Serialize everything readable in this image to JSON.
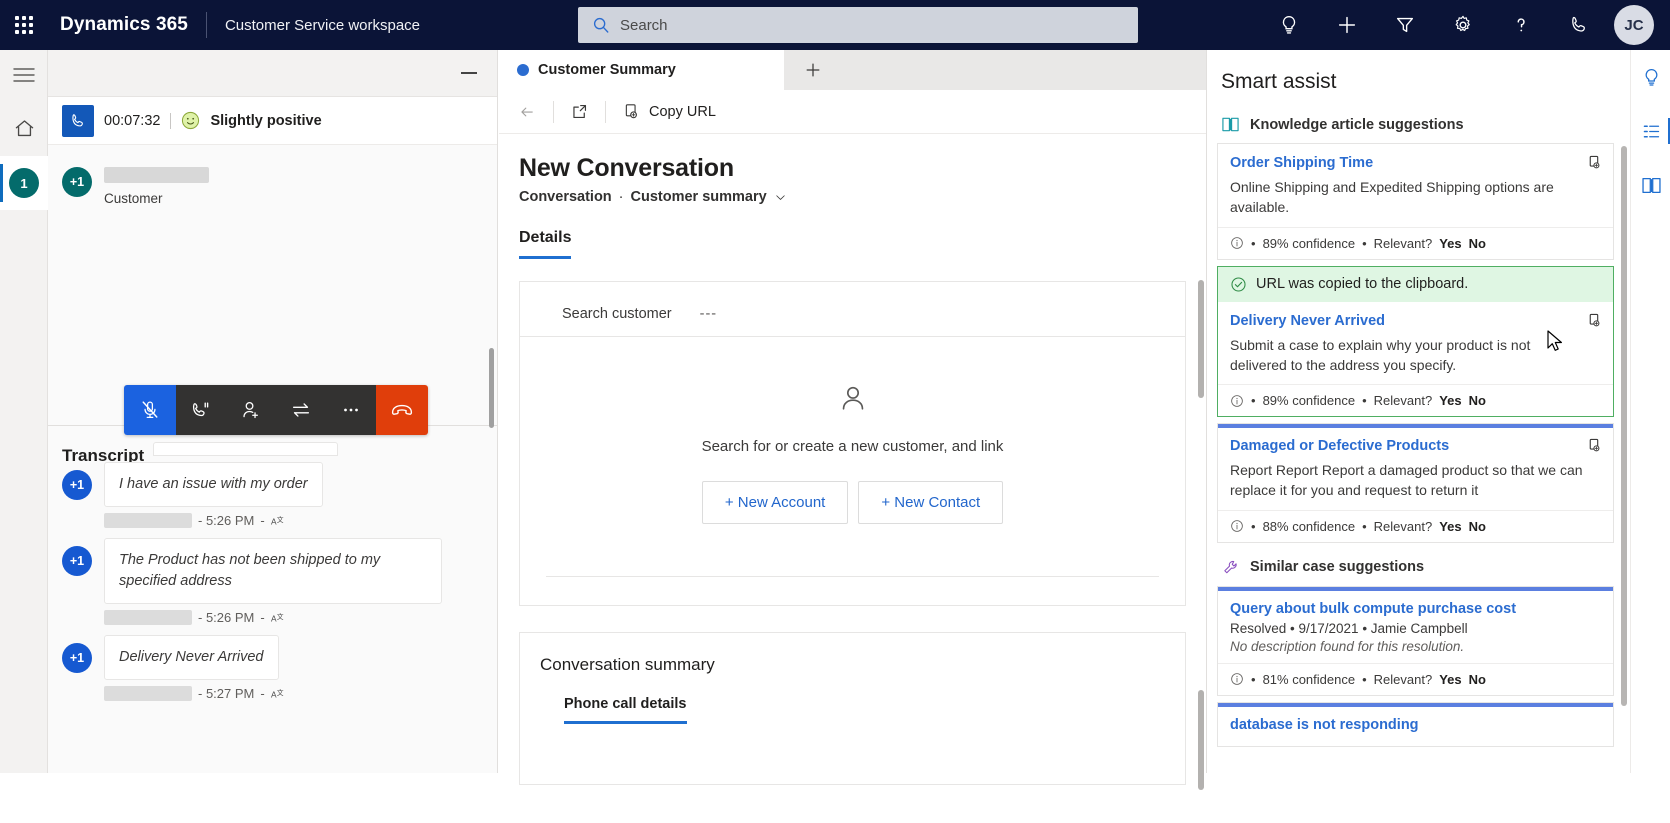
{
  "topnav": {
    "waffle_icon": "waffle-grid-icon",
    "brand": "Dynamics 365",
    "app_name": "Customer Service workspace",
    "search": {
      "placeholder": "Search",
      "value": "",
      "icon": "search-icon"
    },
    "actions": [
      {
        "name": "insights-lightbulb-icon",
        "label": "Insights"
      },
      {
        "name": "plus-icon",
        "label": "New"
      },
      {
        "name": "filter-icon",
        "label": "Filter"
      },
      {
        "name": "gear-icon",
        "label": "Settings"
      },
      {
        "name": "help-question-icon",
        "label": "Help"
      },
      {
        "name": "phone-icon",
        "label": "Call"
      }
    ],
    "avatar_initials": "JC"
  },
  "left_rail": {
    "hamburger_icon": "hamburger-menu-icon",
    "home_icon": "home-icon",
    "session_badge": "1"
  },
  "call_panel": {
    "minimize_label": "Minimize",
    "call_timer": "00:07:32",
    "sentiment_label": "Slightly positive",
    "sentiment_icon": "slightly-positive-face-icon",
    "participant_role": "Customer",
    "participant_avatar": "+1",
    "controls": [
      {
        "name": "mute-microphone-button",
        "label": "Mute",
        "state": "active"
      },
      {
        "name": "hold-call-button",
        "label": "Hold"
      },
      {
        "name": "add-participant-button",
        "label": "Consult"
      },
      {
        "name": "transfer-call-button",
        "label": "Transfer"
      },
      {
        "name": "more-options-button",
        "label": "More"
      },
      {
        "name": "end-call-button",
        "label": "End call"
      }
    ],
    "transcript": {
      "heading": "Transcript",
      "messages": [
        {
          "avatar": "+1",
          "text": "I have an issue with my order",
          "time": "- 5:26 PM",
          "dash": "-",
          "translate_icon": "translate-icon"
        },
        {
          "avatar": "+1",
          "text": "The Product has not been shipped to my specified address",
          "time": "- 5:26 PM",
          "dash": "-",
          "translate_icon": "translate-icon"
        },
        {
          "avatar": "+1",
          "text": "Delivery Never Arrived",
          "time": "- 5:27 PM",
          "dash": "-",
          "translate_icon": "translate-icon"
        }
      ]
    }
  },
  "center": {
    "tab_label": "Customer Summary",
    "new_tab_label": "+",
    "commands": {
      "back_label": "Back",
      "popout_label": "Open in new window",
      "copy_url_label": "Copy URL"
    },
    "page_title": "New Conversation",
    "breadcrumb_entity": "Conversation",
    "breadcrumb_sep": "·",
    "breadcrumb_form": "Customer summary",
    "details_tab": "Details",
    "search_customer_label": "Search customer",
    "search_customer_value": "---",
    "empty_state_text": "Search for or create a new customer, and link",
    "new_account_btn": "+ New Account",
    "new_contact_btn": "+ New Contact",
    "conversation_summary_title": "Conversation summary",
    "phone_call_details_tab": "Phone call details"
  },
  "smart_assist": {
    "title": "Smart assist",
    "sections": [
      {
        "heading": "Knowledge article suggestions",
        "icon": "knowledge-book-icon",
        "cards": [
          {
            "title": "Order Shipping Time",
            "description": "Online Shipping and Expedited Shipping options are available.",
            "confidence": "89% confidence",
            "relevant_label": "Relevant?",
            "yes": "Yes",
            "no": "No",
            "info_icon": "info-circle-icon",
            "copy_icon": "copy-link-icon",
            "bullet": "•"
          },
          {
            "toast": "URL was copied to the clipboard.",
            "toast_icon": "check-circle-icon",
            "title": "Delivery Never Arrived",
            "description": "Submit a case to explain why your product is not delivered to the address you specify.",
            "confidence": "89% confidence",
            "relevant_label": "Relevant?",
            "yes": "Yes",
            "no": "No",
            "info_icon": "info-circle-icon",
            "copy_icon": "copy-link-icon",
            "bullet": "•"
          },
          {
            "title": "Damaged or Defective Products",
            "description": "Report Report Report a damaged product so that we can replace it for you and request to return it",
            "confidence": "88% confidence",
            "relevant_label": "Relevant?",
            "yes": "Yes",
            "no": "No",
            "info_icon": "info-circle-icon",
            "copy_icon": "copy-link-icon",
            "bullet": "•"
          }
        ]
      },
      {
        "heading": "Similar case suggestions",
        "icon": "wrench-icon",
        "cards": [
          {
            "title": "Query about bulk compute purchase cost",
            "meta": "Resolved • 9/17/2021 • Jamie Campbell",
            "description_italic": "No description found for this resolution.",
            "confidence": "81% confidence",
            "relevant_label": "Relevant?",
            "yes": "Yes",
            "no": "No",
            "info_icon": "info-circle-icon",
            "bullet": "•"
          },
          {
            "title": "database is not responding"
          }
        ]
      }
    ]
  },
  "right_rail": {
    "items": [
      {
        "name": "productivity-lightbulb-icon",
        "label": "Productivity pane"
      },
      {
        "name": "agenda-list-icon",
        "label": "Agent scripts",
        "active": true
      },
      {
        "name": "knowledge-book-icon",
        "label": "Knowledge search"
      }
    ]
  },
  "colors": {
    "nav_bg": "#0b1437",
    "accent_blue": "#2b6cd0",
    "teal_avatar": "#046b6b",
    "blue_avatar": "#1659d1",
    "end_call_red": "#e03e0b",
    "mute_blue": "#1b62e0",
    "success_green": "#dff6e3"
  }
}
